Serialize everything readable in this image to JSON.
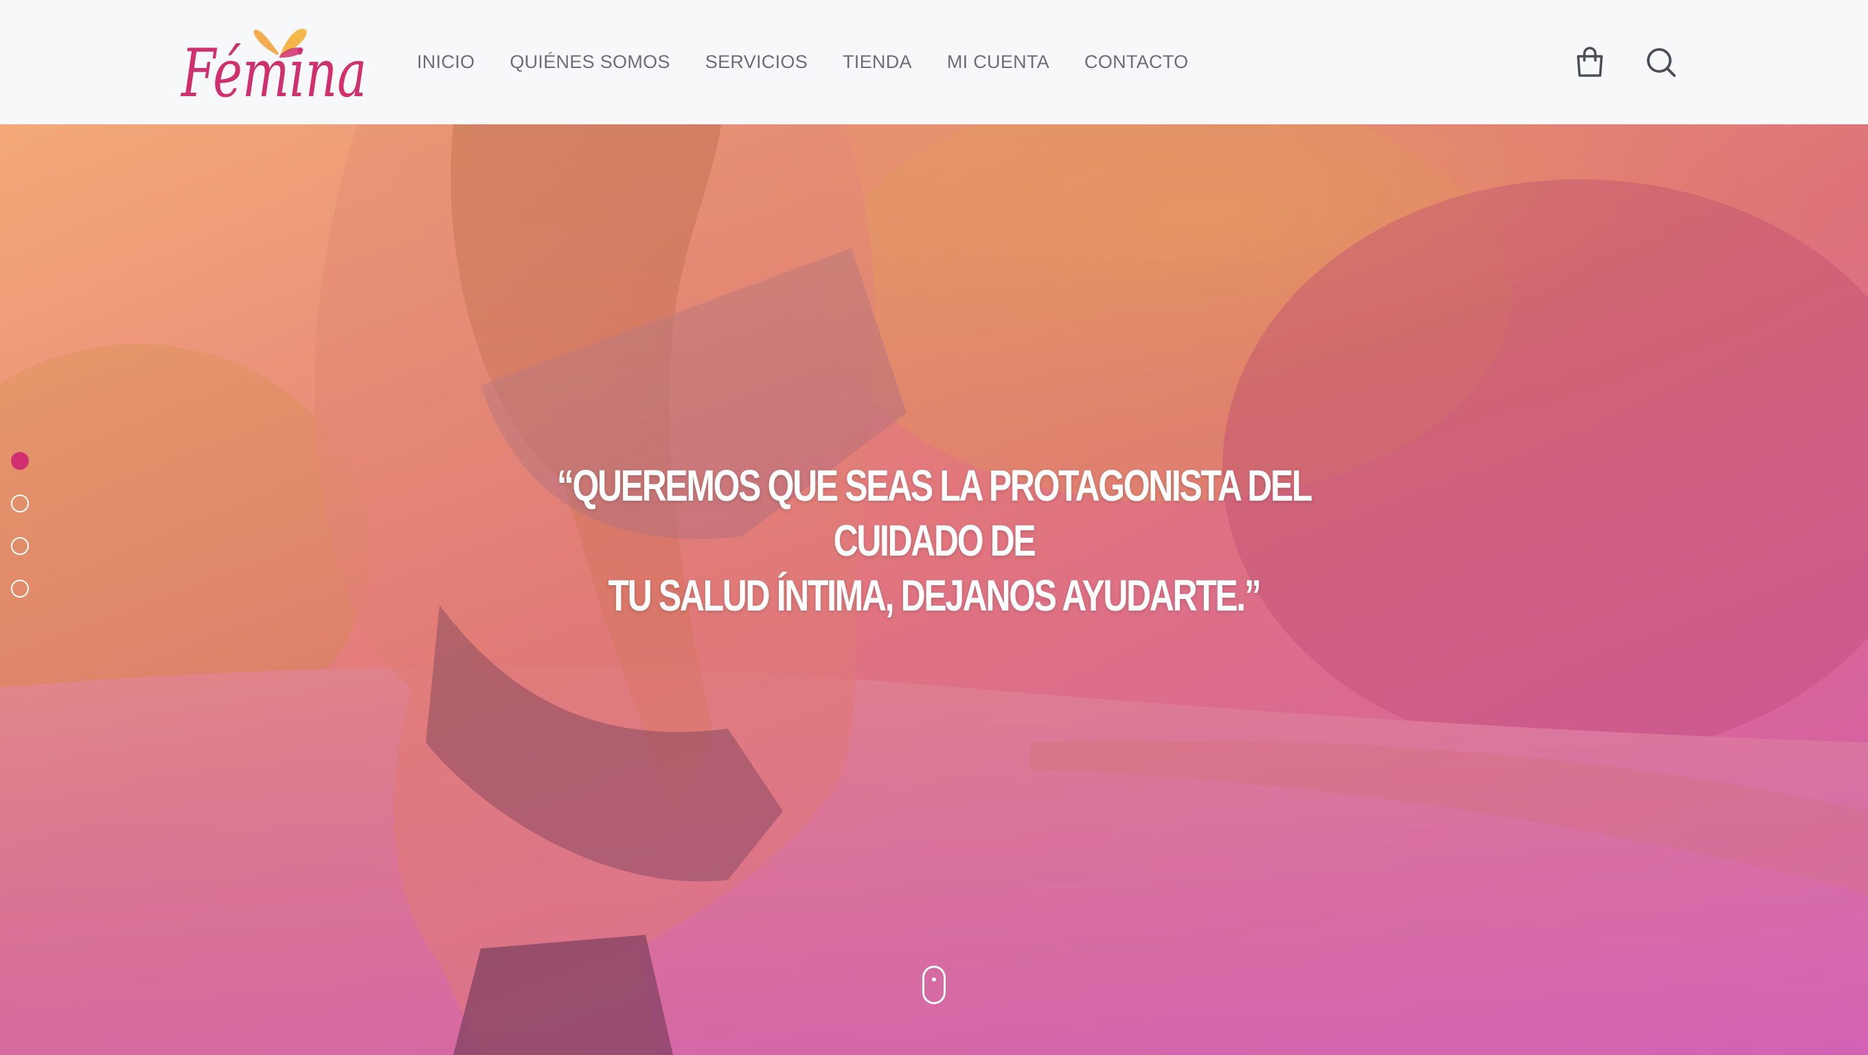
{
  "brand": {
    "logo_text": "Fémina",
    "logo_color": "#d1306f",
    "butterfly_colors": [
      "#f3a33b",
      "#d1306f"
    ]
  },
  "nav": {
    "items": [
      "INICIO",
      "QUIÉNES SOMOS",
      "SERVICIOS",
      "TIENDA",
      "MI CUENTA",
      "CONTACTO"
    ]
  },
  "header_icons": {
    "cart": "shopping-bag-icon",
    "search": "search-icon"
  },
  "hero": {
    "quote_line1": "“QUEREMOS QUE SEAS LA PROTAGONISTA DEL CUIDADO DE",
    "quote_line2": "TU SALUD ÍNTIMA, DEJANOS AYUDARTE.”",
    "slides_total": 4,
    "active_slide": 1,
    "active_color": "#d1306f",
    "scroll_indicator": "mouse-scroll-icon"
  }
}
